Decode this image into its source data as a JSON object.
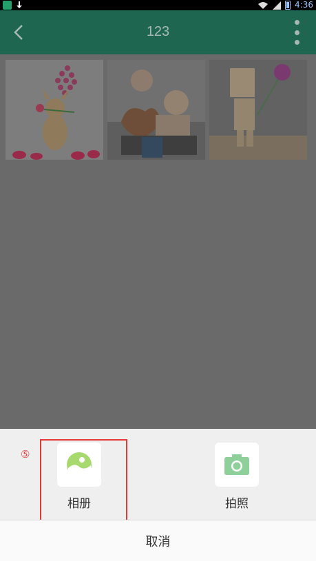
{
  "status_bar": {
    "time": "4:36",
    "icons": [
      "app-notification-icon",
      "download-icon",
      "wifi-icon",
      "signal-icon",
      "battery-icon"
    ]
  },
  "toolbar": {
    "title": "123",
    "back_icon": "back-arrow-icon",
    "more_icon": "more-vertical-icon",
    "color": "#1f6651"
  },
  "gallery": {
    "items": [
      {
        "subject": "chihuahua-with-rose-photo"
      },
      {
        "subject": "children-with-heart-photo"
      },
      {
        "subject": "danbo-with-flower-photo"
      }
    ]
  },
  "sheet": {
    "step_marker": "⑤",
    "options": [
      {
        "label": "相册",
        "icon": "album-icon"
      },
      {
        "label": "拍照",
        "icon": "camera-icon"
      }
    ],
    "cancel_label": "取消",
    "highlight_color": "#e53935",
    "accent_color": "#8fcf9a"
  }
}
